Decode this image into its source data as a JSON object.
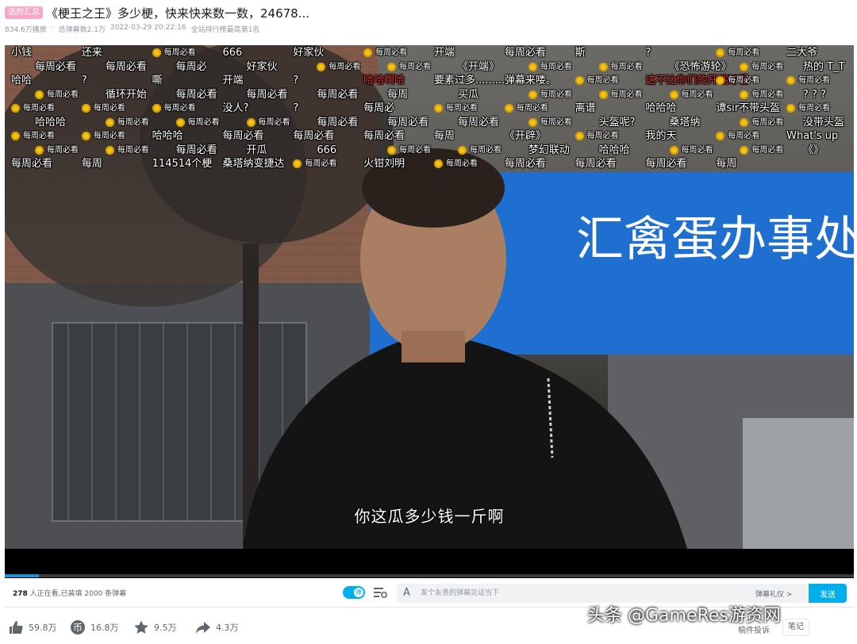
{
  "header": {
    "badge": "选的汇总",
    "title": "《梗王之王》多少梗，快来快来数一数，24678...",
    "meta": {
      "plays": "834.6万播放",
      "danmaku_total": "总弹幕数2.1万",
      "datetime": "2022-03-29 20:22:16",
      "rank": "全站排行榜最高第1名"
    }
  },
  "player": {
    "subtitle": "你这瓜多少钱一斤啊",
    "progress_fraction": 0.04,
    "scene_sign": "汇禽蛋办事处",
    "danmaku": [
      {
        "text": "小钱",
        "style": "plain"
      },
      {
        "text": "还来",
        "style": "plain"
      },
      {
        "text": "每周必看",
        "style": "tag"
      },
      {
        "text": "666",
        "style": "plain"
      },
      {
        "text": "好家伙",
        "style": "plain"
      },
      {
        "text": "每周必看",
        "style": "tag"
      },
      {
        "text": "开端",
        "style": "plain"
      },
      {
        "text": "每周必看",
        "style": "plain"
      },
      {
        "text": "斯",
        "style": "plain"
      },
      {
        "text": "?",
        "style": "plain"
      },
      {
        "text": "每周必看",
        "style": "tag"
      },
      {
        "text": "二大爷",
        "style": "plain"
      },
      {
        "text": "每周必看",
        "style": "plain"
      },
      {
        "text": "每周必看",
        "style": "plain"
      },
      {
        "text": "每周必",
        "style": "plain"
      },
      {
        "text": "好家伙",
        "style": "plain"
      },
      {
        "text": "每周必看",
        "style": "tag"
      },
      {
        "text": "每周必看",
        "style": "tag"
      },
      {
        "text": "《开端》",
        "style": "plain"
      },
      {
        "text": "每周必看",
        "style": "tag"
      },
      {
        "text": "每周必看",
        "style": "tag"
      },
      {
        "text": "《恐怖游轮》",
        "style": "plain"
      },
      {
        "text": "每周必看",
        "style": "tag"
      },
      {
        "text": "热的 T_T",
        "style": "plain"
      },
      {
        "text": "哈哈",
        "style": "plain"
      },
      {
        "text": "?",
        "style": "plain"
      },
      {
        "text": "嘶",
        "style": "plain"
      },
      {
        "text": "开端",
        "style": "plain"
      },
      {
        "text": "?",
        "style": "plain"
      },
      {
        "text": "哈哈啊哈",
        "style": "red"
      },
      {
        "text": "要素过多..........",
        "style": "plain"
      },
      {
        "text": "弹幕来喽。",
        "style": "plain"
      },
      {
        "text": "每周必看",
        "style": "tag"
      },
      {
        "text": "这不比你们的开端好看",
        "style": "red"
      },
      {
        "text": "每周必看",
        "style": "tag"
      },
      {
        "text": "每周必看",
        "style": "tag"
      },
      {
        "text": "每周必看",
        "style": "tag"
      },
      {
        "text": "循环开始",
        "style": "plain"
      },
      {
        "text": "每周必看",
        "style": "plain"
      },
      {
        "text": "每周必看",
        "style": "plain"
      },
      {
        "text": "每周必看",
        "style": "plain"
      },
      {
        "text": "每周",
        "style": "plain"
      },
      {
        "text": "买瓜",
        "style": "plain"
      },
      {
        "text": "每周必看",
        "style": "tag"
      },
      {
        "text": "每周必看",
        "style": "tag"
      },
      {
        "text": "每周必看",
        "style": "tag"
      },
      {
        "text": "每周必看",
        "style": "tag"
      },
      {
        "text": "? ? ?",
        "style": "plain"
      },
      {
        "text": "每周必看",
        "style": "tag"
      },
      {
        "text": "每周必看",
        "style": "tag"
      },
      {
        "text": "每周必看",
        "style": "tag"
      },
      {
        "text": "没人?",
        "style": "plain"
      },
      {
        "text": "?",
        "style": "plain"
      },
      {
        "text": "每周必",
        "style": "plain"
      },
      {
        "text": "每周必看",
        "style": "tag"
      },
      {
        "text": "每周必看",
        "style": "tag"
      },
      {
        "text": "离谱",
        "style": "plain"
      },
      {
        "text": "哈哈哈",
        "style": "plain"
      },
      {
        "text": "谭sir不带头盔",
        "style": "plain"
      },
      {
        "text": "每周必看",
        "style": "tag"
      },
      {
        "text": "哈哈哈",
        "style": "plain"
      },
      {
        "text": "每周必看",
        "style": "tag"
      },
      {
        "text": "每周必看",
        "style": "tag"
      },
      {
        "text": "每周必看",
        "style": "tag"
      },
      {
        "text": "每周必看",
        "style": "plain"
      },
      {
        "text": "每周必看",
        "style": "plain"
      },
      {
        "text": "每周必看",
        "style": "plain"
      },
      {
        "text": "每周必看",
        "style": "tag"
      },
      {
        "text": "头盔呢?",
        "style": "plain"
      },
      {
        "text": "桑塔纳",
        "style": "plain"
      },
      {
        "text": "每周必看",
        "style": "tag"
      },
      {
        "text": "没带头盔",
        "style": "plain"
      },
      {
        "text": "每周必看",
        "style": "tag"
      },
      {
        "text": "每周必看",
        "style": "tag"
      },
      {
        "text": "哈哈哈",
        "style": "plain"
      },
      {
        "text": "每周必看",
        "style": "plain"
      },
      {
        "text": "每周必看",
        "style": "plain"
      },
      {
        "text": "每周必看",
        "style": "plain"
      },
      {
        "text": "每周",
        "style": "plain"
      },
      {
        "text": "《开辟》",
        "style": "plain"
      },
      {
        "text": "每周必看",
        "style": "tag"
      },
      {
        "text": "我的天",
        "style": "plain"
      },
      {
        "text": "每周必看",
        "style": "tag"
      },
      {
        "text": "What's up",
        "style": "plain"
      },
      {
        "text": "每周必看",
        "style": "tag"
      },
      {
        "text": "每周必看",
        "style": "tag"
      },
      {
        "text": "每周必看",
        "style": "plain"
      },
      {
        "text": "开瓜",
        "style": "plain"
      },
      {
        "text": "666",
        "style": "plain"
      },
      {
        "text": "每周必看",
        "style": "tag"
      },
      {
        "text": "每周必看",
        "style": "tag"
      },
      {
        "text": "梦幻联动",
        "style": "plain"
      },
      {
        "text": "哈哈哈",
        "style": "plain"
      },
      {
        "text": "每周必看",
        "style": "tag"
      },
      {
        "text": "每周必看",
        "style": "tag"
      },
      {
        "text": "《》",
        "style": "plain"
      },
      {
        "text": "每周必看",
        "style": "plain"
      },
      {
        "text": "每周",
        "style": "plain"
      },
      {
        "text": "114514个梗",
        "style": "plain"
      },
      {
        "text": "桑塔纳变捷达",
        "style": "plain"
      },
      {
        "text": "每周必看",
        "style": "tag"
      },
      {
        "text": "火钳刘明",
        "style": "plain"
      },
      {
        "text": "每周必看",
        "style": "tag"
      },
      {
        "text": "每周必看",
        "style": "plain"
      },
      {
        "text": "每周必看",
        "style": "plain"
      },
      {
        "text": "每周必看",
        "style": "plain"
      },
      {
        "text": "每周",
        "style": "plain"
      }
    ]
  },
  "sendbar": {
    "viewers_count": "278",
    "viewers_text": "人正在看,已装填 2000 条弹幕",
    "input_icon": "A",
    "placeholder": "发个友善的弹幕见证当下",
    "etiquette": "弹幕礼仪 >",
    "send_label": "发送"
  },
  "actions": {
    "like": "59.8万",
    "coin": "16.8万",
    "favorite": "9.5万",
    "share": "4.3万",
    "report": "稿件投诉",
    "notes": "笔记"
  },
  "watermark": "头条 @GameRes游资网",
  "colors": {
    "accent": "#00aeec",
    "danmaku_red": "#e0302b",
    "badge_pink": "#f7a8c7",
    "tag_gold": "#f0c419"
  }
}
